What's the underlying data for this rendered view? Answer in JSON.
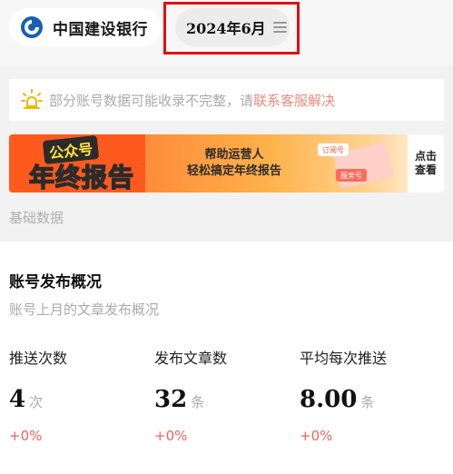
{
  "header": {
    "bank_name": "中国建设银行",
    "date": "2024年6月"
  },
  "notice": {
    "text": "部分账号数据可能收录不完整，请",
    "link": "联系客服解决"
  },
  "banner": {
    "title_line1": "公众号",
    "title_line2": "年终报告",
    "slogan_line1": "帮助运营人",
    "slogan_line2": "轻松搞定年终报告",
    "tag1": "订阅号",
    "tag2": "服务号",
    "cta": "点击查看"
  },
  "section": {
    "label": "基础数据"
  },
  "card": {
    "title": "账号发布概况",
    "subtitle": "账号上月的文章发布概况",
    "stats": [
      {
        "label": "推送次数",
        "value": "4",
        "unit": "次",
        "change": "+0%"
      },
      {
        "label": "发布文章数",
        "value": "32",
        "unit": "条",
        "change": "+0%"
      },
      {
        "label": "平均每次推送",
        "value": "8.00",
        "unit": "条",
        "change": "+0%"
      }
    ]
  },
  "colors": {
    "accent_red": "#e01010",
    "change_red": "#f0645a",
    "link": "#f08a7a",
    "banner_orange": "#ff5a1e",
    "bank_blue": "#1a5fb4"
  }
}
